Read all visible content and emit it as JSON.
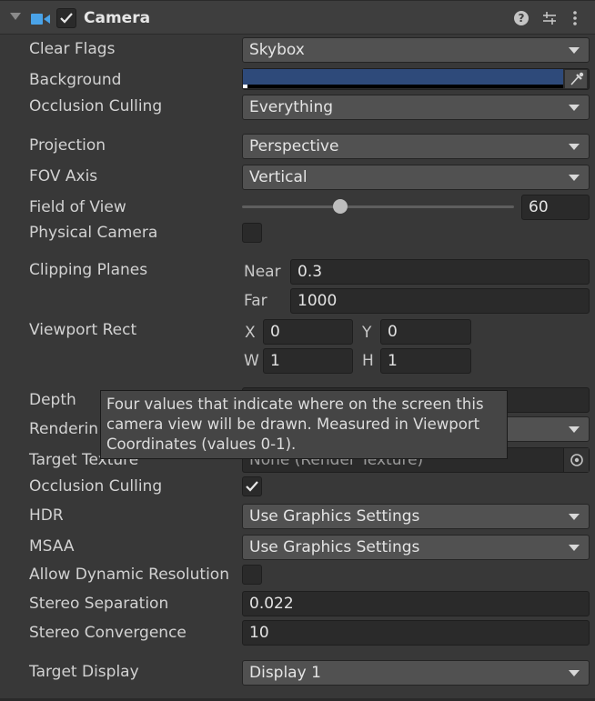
{
  "component": {
    "title": "Camera"
  },
  "colors": {
    "background_swatch": "#2e4a7a"
  },
  "fields": {
    "clear_flags": {
      "label": "Clear Flags",
      "value": "Skybox"
    },
    "background": {
      "label": "Background"
    },
    "occlusion_culling_mask": {
      "label": "Occlusion Culling",
      "value": "Everything"
    },
    "projection": {
      "label": "Projection",
      "value": "Perspective"
    },
    "fov_axis": {
      "label": "FOV Axis",
      "value": "Vertical"
    },
    "field_of_view": {
      "label": "Field of View",
      "value": "60",
      "slider_fraction": 0.36
    },
    "physical_camera": {
      "label": "Physical Camera",
      "checked": false
    },
    "clipping_planes": {
      "label": "Clipping Planes",
      "near_label": "Near",
      "near": "0.3",
      "far_label": "Far",
      "far": "1000"
    },
    "viewport_rect": {
      "label": "Viewport Rect",
      "x_label": "X",
      "x": "0",
      "y_label": "Y",
      "y": "0",
      "w_label": "W",
      "w": "1",
      "h_label": "H",
      "h": "1"
    },
    "depth": {
      "label": "Depth"
    },
    "rendering_path": {
      "label": "Renderin"
    },
    "target_texture": {
      "label": "Target Texture",
      "value": "None (Render Texture)"
    },
    "occlusion_culling": {
      "label": "Occlusion Culling",
      "checked": true
    },
    "hdr": {
      "label": "HDR",
      "value": "Use Graphics Settings"
    },
    "msaa": {
      "label": "MSAA",
      "value": "Use Graphics Settings"
    },
    "allow_dynamic_resolution": {
      "label": "Allow Dynamic Resolution",
      "checked": false
    },
    "stereo_separation": {
      "label": "Stereo Separation",
      "value": "0.022"
    },
    "stereo_convergence": {
      "label": "Stereo Convergence",
      "value": "10"
    },
    "target_display": {
      "label": "Target Display",
      "value": "Display 1"
    }
  },
  "tooltip": {
    "line1": "Four values that indicate where on the screen this",
    "line2": "camera view will be drawn. Measured in Viewport",
    "line3": "Coordinates (values 0-1)."
  }
}
